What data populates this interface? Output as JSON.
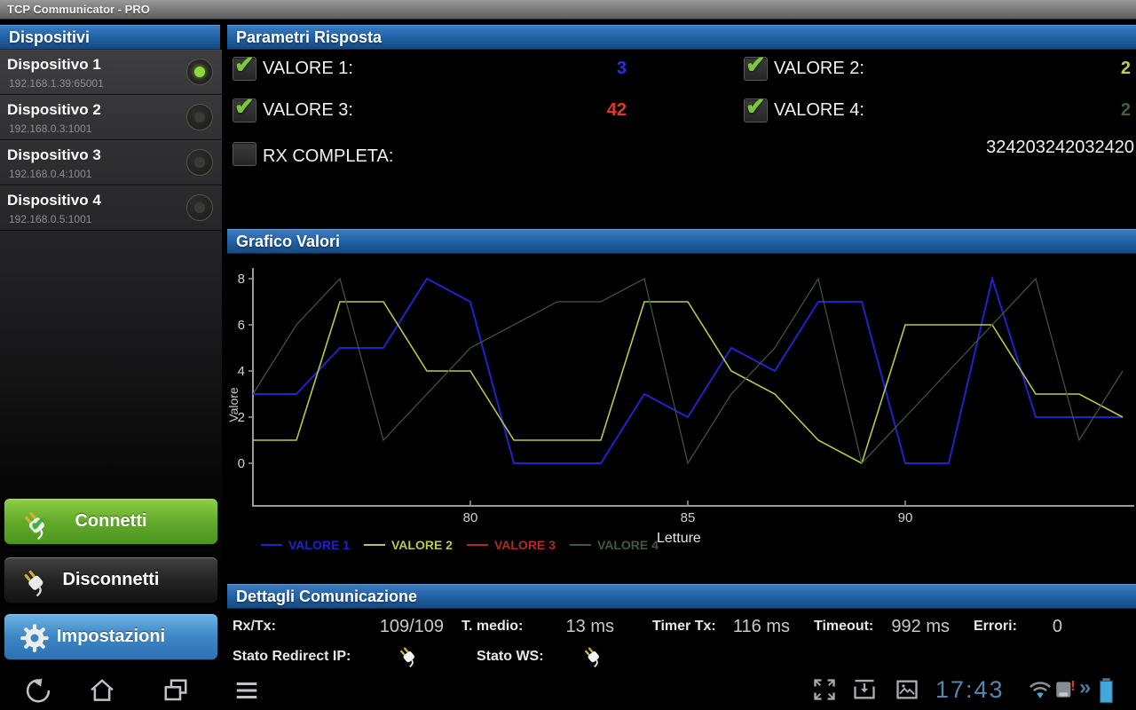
{
  "title_bar": {
    "title": "TCP Communicator - PRO"
  },
  "sidebar": {
    "header": "Dispositivi",
    "devices": [
      {
        "name": "Dispositivo 1",
        "ip": "192.168.1.39:65001",
        "selected": true
      },
      {
        "name": "Dispositivo 2",
        "ip": "192.168.0.3:1001",
        "selected": false
      },
      {
        "name": "Dispositivo 3",
        "ip": "192.168.0.4:1001",
        "selected": false
      },
      {
        "name": "Dispositivo 4",
        "ip": "192.168.0.5:1001",
        "selected": false
      }
    ],
    "buttons": {
      "connect": "Connetti",
      "disconnect": "Disconnetti",
      "settings": "Impostazioni"
    }
  },
  "parametri": {
    "header": "Parametri Risposta",
    "items": [
      {
        "label": "VALORE 1:",
        "value": "3",
        "value_color": "#2a2de8",
        "checked": true
      },
      {
        "label": "VALORE 2:",
        "value": "2",
        "value_color": "#bdcb4e",
        "checked": true
      },
      {
        "label": "VALORE 3:",
        "value": "42",
        "value_color": "#df372b",
        "checked": true
      },
      {
        "label": "VALORE 4:",
        "value": "2",
        "value_color": "#41603f",
        "checked": true
      }
    ],
    "rx_completa": {
      "label": "RX COMPLETA:",
      "value": "324203242032420",
      "checked": false
    }
  },
  "grafico": {
    "header": "Grafico Valori"
  },
  "chart_data": {
    "type": "line",
    "title": "Grafico Valori",
    "xlabel": "Letture",
    "ylabel": "Valore",
    "x": [
      75,
      76,
      77,
      78,
      79,
      80,
      81,
      82,
      83,
      84,
      85,
      86,
      87,
      88,
      89,
      90,
      91,
      92,
      93,
      94,
      95
    ],
    "x_ticks": [
      80,
      85,
      90
    ],
    "y_ticks": [
      0,
      2,
      4,
      6,
      8
    ],
    "ylim": [
      0,
      8
    ],
    "grid": false,
    "legend_position": "bottom",
    "series": [
      {
        "name": "VALORE 1",
        "color": "#2222cc",
        "width": 2,
        "values": [
          3,
          3,
          5,
          5,
          8,
          7,
          0,
          0,
          0,
          3,
          2,
          5,
          4,
          7,
          7,
          0,
          0,
          8,
          2,
          2,
          2
        ]
      },
      {
        "name": "VALORE 2",
        "color": "#b9c94b",
        "width": 1.6,
        "values": [
          1,
          1,
          7,
          7,
          4,
          4,
          1,
          1,
          1,
          7,
          7,
          4,
          3,
          1,
          0,
          6,
          6,
          6,
          3,
          3,
          2
        ]
      },
      {
        "name": "VALORE 3",
        "color": "#b22a22",
        "width": 1.4,
        "values": null,
        "note": "current value 42 is above y-range, line not visible"
      },
      {
        "name": "VALORE 4",
        "color": "#3d5c3d",
        "width": 1.2,
        "values": [
          3,
          6,
          8,
          1,
          3,
          5,
          6,
          7,
          7,
          8,
          0,
          3,
          5,
          8,
          0,
          2,
          4,
          6,
          8,
          1,
          4
        ]
      }
    ]
  },
  "dettagli": {
    "header": "Dettagli Comunicazione",
    "stats": [
      {
        "label": "Rx/Tx:",
        "value": "109/109"
      },
      {
        "label": "T. medio:",
        "value": "13 ms"
      },
      {
        "label": "Timer Tx:",
        "value": "116 ms"
      },
      {
        "label": "Timeout:",
        "value": "992 ms"
      },
      {
        "label": "Errori:",
        "value": "0"
      }
    ],
    "stato_redirect_label": "Stato Redirect IP:",
    "stato_ws_label": "Stato WS:"
  },
  "status_bar": {
    "time": "17:43",
    "chevron": "»"
  }
}
